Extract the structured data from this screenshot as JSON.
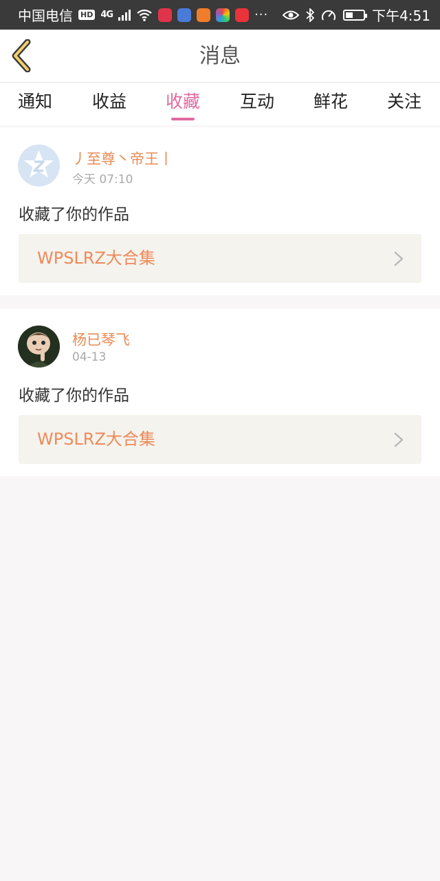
{
  "status_bar": {
    "carrier": "中国电信",
    "hd": "HD",
    "network": "4G",
    "more": "···",
    "time": "下午4:51"
  },
  "nav": {
    "title": "消息",
    "back_icon": "chevron-left-icon"
  },
  "tabs": [
    {
      "label": "通知",
      "active": false
    },
    {
      "label": "收益",
      "active": false
    },
    {
      "label": "收藏",
      "active": true
    },
    {
      "label": "互动",
      "active": false
    },
    {
      "label": "鲜花",
      "active": false
    },
    {
      "label": "关注",
      "active": false
    }
  ],
  "messages": [
    {
      "username": "丿至尊丶帝王丨",
      "time": "今天 07:10",
      "action": "收藏了你的作品",
      "work_title": "WPSLRZ大合集"
    },
    {
      "username": "杨已琴飞",
      "time": "04-13",
      "action": "收藏了你的作品",
      "work_title": "WPSLRZ大合集"
    }
  ],
  "colors": {
    "accent": "#e06aa0",
    "username": "#e88b55",
    "work_title": "#ee8a59",
    "status_bar_bg": "#3a3a3a",
    "page_bg": "#f8f6f6"
  }
}
